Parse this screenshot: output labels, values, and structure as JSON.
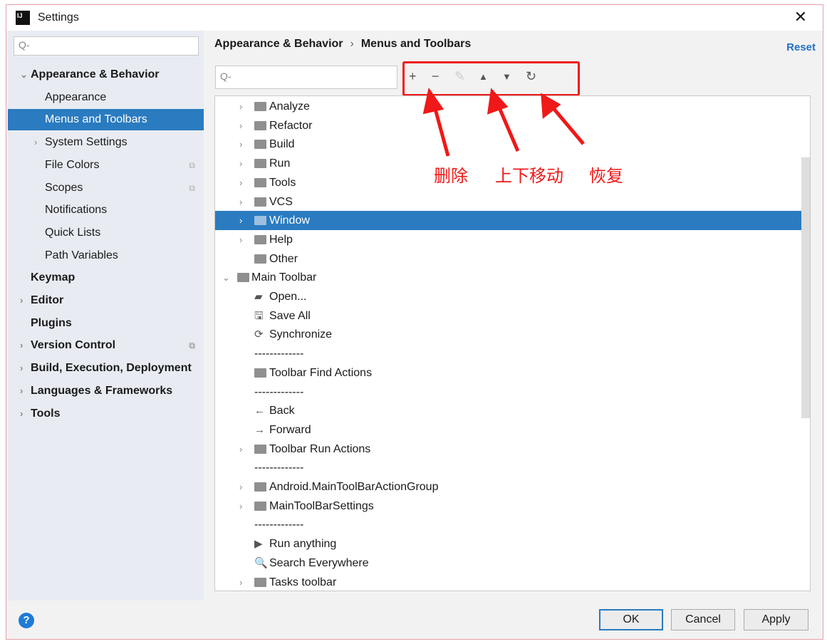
{
  "window": {
    "title": "Settings",
    "close": "✕"
  },
  "sidebar": {
    "search_placeholder": "Q-",
    "items": [
      {
        "label": "Appearance & Behavior",
        "level": 0,
        "bold": true,
        "chev": "⌄"
      },
      {
        "label": "Appearance",
        "level": 1
      },
      {
        "label": "Menus and Toolbars",
        "level": 1,
        "selected": true
      },
      {
        "label": "System Settings",
        "level": 1,
        "chev": "›"
      },
      {
        "label": "File Colors",
        "level": 1,
        "badge": "⧉"
      },
      {
        "label": "Scopes",
        "level": 1,
        "badge": "⧉"
      },
      {
        "label": "Notifications",
        "level": 1
      },
      {
        "label": "Quick Lists",
        "level": 1
      },
      {
        "label": "Path Variables",
        "level": 1
      },
      {
        "label": "Keymap",
        "level": 0,
        "bold": true
      },
      {
        "label": "Editor",
        "level": 0,
        "bold": true,
        "chev": "›"
      },
      {
        "label": "Plugins",
        "level": 0,
        "bold": true
      },
      {
        "label": "Version Control",
        "level": 0,
        "bold": true,
        "chev": "›",
        "badge": "⧉"
      },
      {
        "label": "Build, Execution, Deployment",
        "level": 0,
        "bold": true,
        "chev": "›"
      },
      {
        "label": "Languages & Frameworks",
        "level": 0,
        "bold": true,
        "chev": "›"
      },
      {
        "label": "Tools",
        "level": 0,
        "bold": true,
        "chev": "›"
      }
    ]
  },
  "breadcrumb": {
    "parent": "Appearance & Behavior",
    "sep": "›",
    "current": "Menus and Toolbars"
  },
  "reset": "Reset",
  "search_placeholder": "Q-",
  "toolbar": {
    "add": "+",
    "remove": "−",
    "edit": "✎",
    "up": "▲",
    "down": "▼",
    "restore": "↻"
  },
  "annotations": {
    "delete": "删除",
    "move": "上下移动",
    "restore": "恢复",
    "color": "#f01818"
  },
  "tree": [
    {
      "label": "Analyze",
      "level": 1,
      "chev": true,
      "icon": "folder"
    },
    {
      "label": "Refactor",
      "level": 1,
      "chev": true,
      "icon": "folder"
    },
    {
      "label": "Build",
      "level": 1,
      "chev": true,
      "icon": "folder"
    },
    {
      "label": "Run",
      "level": 1,
      "chev": true,
      "icon": "folder"
    },
    {
      "label": "Tools",
      "level": 1,
      "chev": true,
      "icon": "folder"
    },
    {
      "label": "VCS",
      "level": 1,
      "chev": true,
      "icon": "folder"
    },
    {
      "label": "Window",
      "level": 1,
      "chev": true,
      "icon": "folder",
      "selected": true
    },
    {
      "label": "Help",
      "level": 1,
      "chev": true,
      "icon": "folder"
    },
    {
      "label": "Other",
      "level": 1,
      "icon": "folder"
    },
    {
      "label": "Main Toolbar",
      "level": 0,
      "chev": "open",
      "icon": "folder"
    },
    {
      "label": "Open...",
      "level": 1,
      "icon": "open"
    },
    {
      "label": "Save All",
      "level": 1,
      "icon": "save"
    },
    {
      "label": "Synchronize",
      "level": 1,
      "icon": "sync"
    },
    {
      "label": "-------------",
      "level": 1
    },
    {
      "label": "Toolbar Find Actions",
      "level": 1,
      "icon": "folder"
    },
    {
      "label": "-------------",
      "level": 1
    },
    {
      "label": "Back",
      "level": 1,
      "icon": "back"
    },
    {
      "label": "Forward",
      "level": 1,
      "icon": "forward"
    },
    {
      "label": "Toolbar Run Actions",
      "level": 1,
      "chev": true,
      "icon": "folder"
    },
    {
      "label": "-------------",
      "level": 1
    },
    {
      "label": "Android.MainToolBarActionGroup",
      "level": 1,
      "chev": true,
      "icon": "folder"
    },
    {
      "label": "MainToolBarSettings",
      "level": 1,
      "chev": true,
      "icon": "folder"
    },
    {
      "label": "-------------",
      "level": 1
    },
    {
      "label": "Run anything",
      "level": 1,
      "icon": "run"
    },
    {
      "label": "Search Everywhere",
      "level": 1,
      "icon": "search"
    },
    {
      "label": "Tasks toolbar",
      "level": 1,
      "chev": true,
      "icon": "folder"
    }
  ],
  "buttons": {
    "help": "?",
    "ok": "OK",
    "cancel": "Cancel",
    "apply": "Apply"
  }
}
